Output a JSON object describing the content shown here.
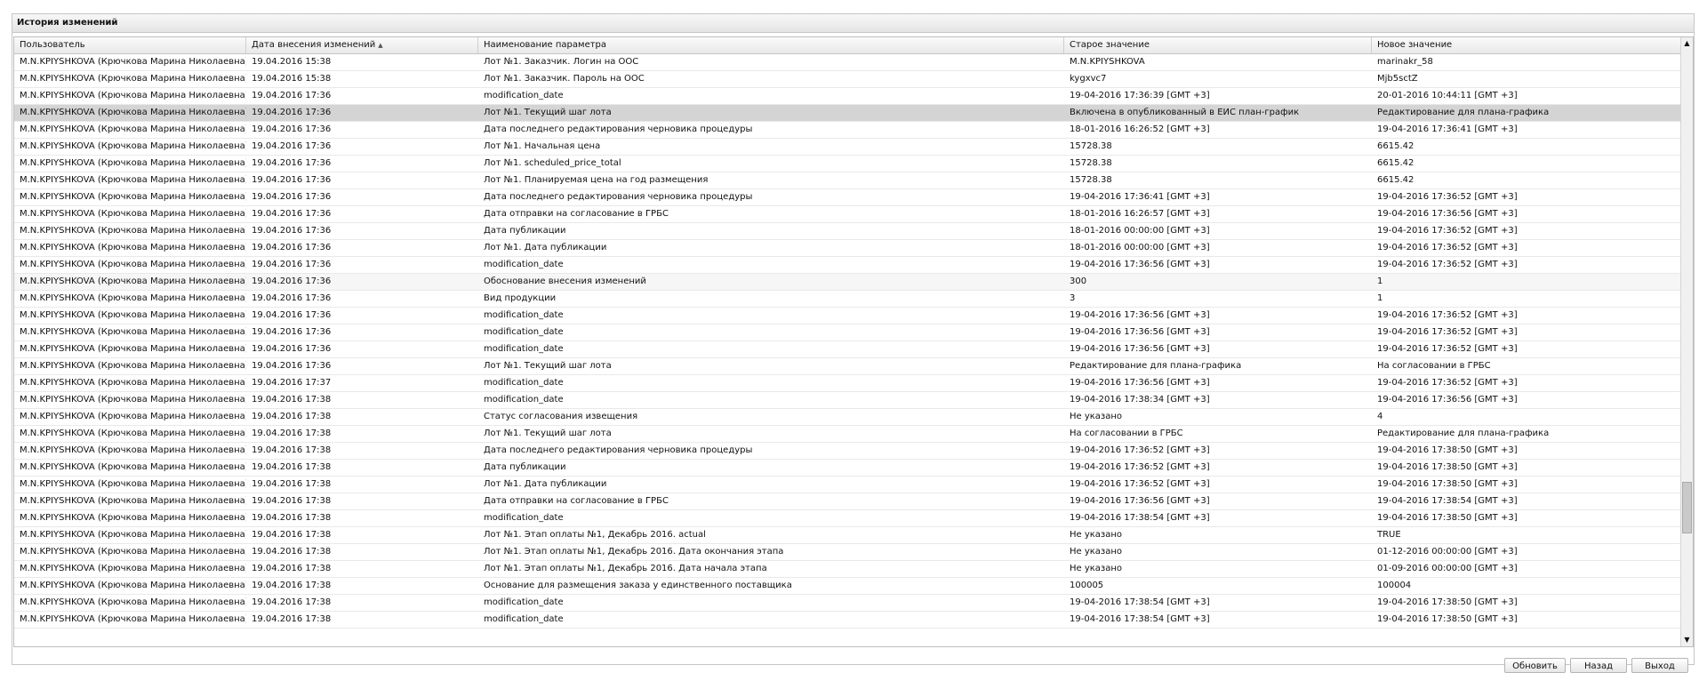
{
  "panel": {
    "title": "История изменений"
  },
  "columns": [
    {
      "label": "Пользователь",
      "sorted": false
    },
    {
      "label": "Дата внесения изменений",
      "sorted": true
    },
    {
      "label": "Наименование параметра",
      "sorted": false
    },
    {
      "label": "Старое значение",
      "sorted": false
    },
    {
      "label": "Новое значение",
      "sorted": false
    }
  ],
  "sort_icon": "sort-ascending-icon",
  "rows": [
    [
      "M.N.KPIYSHKOVA (Крючкова Марина Николаевна)",
      "19.04.2016 15:38",
      "Лот №1. Заказчик. Логин на ООС",
      "M.N.KPIYSHKOVA",
      "marinakr_58"
    ],
    [
      "M.N.KPIYSHKOVA (Крючкова Марина Николаевна)",
      "19.04.2016 15:38",
      "Лот №1. Заказчик. Пароль на ООС",
      "kygxvc7",
      "Mjb5sctZ"
    ],
    [
      "M.N.KPIYSHKOVA (Крючкова Марина Николаевна)",
      "19.04.2016 17:36",
      "modification_date",
      "19-04-2016 17:36:39 [GMT +3]",
      "20-01-2016 10:44:11 [GMT +3]"
    ],
    [
      "M.N.KPIYSHKOVA (Крючкова Марина Николаевна)",
      "19.04.2016 17:36",
      "Лот №1. Текущий шаг лота",
      "Включена в опубликованный в ЕИС план-график",
      "Редактирование для плана-графика"
    ],
    [
      "M.N.KPIYSHKOVA (Крючкова Марина Николаевна)",
      "19.04.2016 17:36",
      "Дата последнего редактирования черновика процедуры",
      "18-01-2016 16:26:52 [GMT +3]",
      "19-04-2016 17:36:41 [GMT +3]"
    ],
    [
      "M.N.KPIYSHKOVA (Крючкова Марина Николаевна)",
      "19.04.2016 17:36",
      "Лот №1. Начальная цена",
      "15728.38",
      "6615.42"
    ],
    [
      "M.N.KPIYSHKOVA (Крючкова Марина Николаевна)",
      "19.04.2016 17:36",
      "Лот №1. scheduled_price_total",
      "15728.38",
      "6615.42"
    ],
    [
      "M.N.KPIYSHKOVA (Крючкова Марина Николаевна)",
      "19.04.2016 17:36",
      "Лот №1. Планируемая цена на год размещения",
      "15728.38",
      "6615.42"
    ],
    [
      "M.N.KPIYSHKOVA (Крючкова Марина Николаевна)",
      "19.04.2016 17:36",
      "Дата последнего редактирования черновика процедуры",
      "19-04-2016 17:36:41 [GMT +3]",
      "19-04-2016 17:36:52 [GMT +3]"
    ],
    [
      "M.N.KPIYSHKOVA (Крючкова Марина Николаевна)",
      "19.04.2016 17:36",
      "Дата отправки на согласование в ГРБС",
      "18-01-2016 16:26:57 [GMT +3]",
      "19-04-2016 17:36:56 [GMT +3]"
    ],
    [
      "M.N.KPIYSHKOVA (Крючкова Марина Николаевна)",
      "19.04.2016 17:36",
      "Дата публикации",
      "18-01-2016 00:00:00 [GMT +3]",
      "19-04-2016 17:36:52 [GMT +3]"
    ],
    [
      "M.N.KPIYSHKOVA (Крючкова Марина Николаевна)",
      "19.04.2016 17:36",
      "Лот №1. Дата публикации",
      "18-01-2016 00:00:00 [GMT +3]",
      "19-04-2016 17:36:52 [GMT +3]"
    ],
    [
      "M.N.KPIYSHKOVA (Крючкова Марина Николаевна)",
      "19.04.2016 17:36",
      "modification_date",
      "19-04-2016 17:36:56 [GMT +3]",
      "19-04-2016 17:36:52 [GMT +3]"
    ],
    [
      "M.N.KPIYSHKOVA (Крючкова Марина Николаевна)",
      "19.04.2016 17:36",
      "Обоснование внесения изменений",
      "300",
      "1"
    ],
    [
      "M.N.KPIYSHKOVA (Крючкова Марина Николаевна)",
      "19.04.2016 17:36",
      "Вид продукции",
      "3",
      "1"
    ],
    [
      "M.N.KPIYSHKOVA (Крючкова Марина Николаевна)",
      "19.04.2016 17:36",
      "modification_date",
      "19-04-2016 17:36:56 [GMT +3]",
      "19-04-2016 17:36:52 [GMT +3]"
    ],
    [
      "M.N.KPIYSHKOVA (Крючкова Марина Николаевна)",
      "19.04.2016 17:36",
      "modification_date",
      "19-04-2016 17:36:56 [GMT +3]",
      "19-04-2016 17:36:52 [GMT +3]"
    ],
    [
      "M.N.KPIYSHKOVA (Крючкова Марина Николаевна)",
      "19.04.2016 17:36",
      "modification_date",
      "19-04-2016 17:36:56 [GMT +3]",
      "19-04-2016 17:36:52 [GMT +3]"
    ],
    [
      "M.N.KPIYSHKOVA (Крючкова Марина Николаевна)",
      "19.04.2016 17:36",
      "Лот №1. Текущий шаг лота",
      "Редактирование для плана-графика",
      "На согласовании в ГРБС"
    ],
    [
      "M.N.KPIYSHKOVA (Крючкова Марина Николаевна)",
      "19.04.2016 17:37",
      "modification_date",
      "19-04-2016 17:36:56 [GMT +3]",
      "19-04-2016 17:36:52 [GMT +3]"
    ],
    [
      "M.N.KPIYSHKOVA (Крючкова Марина Николаевна)",
      "19.04.2016 17:38",
      "modification_date",
      "19-04-2016 17:38:34 [GMT +3]",
      "19-04-2016 17:36:56 [GMT +3]"
    ],
    [
      "M.N.KPIYSHKOVA (Крючкова Марина Николаевна)",
      "19.04.2016 17:38",
      "Статус согласования извещения",
      "Не указано",
      "4"
    ],
    [
      "M.N.KPIYSHKOVA (Крючкова Марина Николаевна)",
      "19.04.2016 17:38",
      "Лот №1. Текущий шаг лота",
      "На согласовании в ГРБС",
      "Редактирование для плана-графика"
    ],
    [
      "M.N.KPIYSHKOVA (Крючкова Марина Николаевна)",
      "19.04.2016 17:38",
      "Дата последнего редактирования черновика процедуры",
      "19-04-2016 17:36:52 [GMT +3]",
      "19-04-2016 17:38:50 [GMT +3]"
    ],
    [
      "M.N.KPIYSHKOVA (Крючкова Марина Николаевна)",
      "19.04.2016 17:38",
      "Дата публикации",
      "19-04-2016 17:36:52 [GMT +3]",
      "19-04-2016 17:38:50 [GMT +3]"
    ],
    [
      "M.N.KPIYSHKOVA (Крючкова Марина Николаевна)",
      "19.04.2016 17:38",
      "Лот №1. Дата публикации",
      "19-04-2016 17:36:52 [GMT +3]",
      "19-04-2016 17:38:50 [GMT +3]"
    ],
    [
      "M.N.KPIYSHKOVA (Крючкова Марина Николаевна)",
      "19.04.2016 17:38",
      "Дата отправки на согласование в ГРБС",
      "19-04-2016 17:36:56 [GMT +3]",
      "19-04-2016 17:38:54 [GMT +3]"
    ],
    [
      "M.N.KPIYSHKOVA (Крючкова Марина Николаевна)",
      "19.04.2016 17:38",
      "modification_date",
      "19-04-2016 17:38:54 [GMT +3]",
      "19-04-2016 17:38:50 [GMT +3]"
    ],
    [
      "M.N.KPIYSHKOVA (Крючкова Марина Николаевна)",
      "19.04.2016 17:38",
      "Лот №1. Этап оплаты №1, Декабрь 2016. actual",
      "Не указано",
      "TRUE"
    ],
    [
      "M.N.KPIYSHKOVA (Крючкова Марина Николаевна)",
      "19.04.2016 17:38",
      "Лот №1. Этап оплаты №1, Декабрь 2016. Дата окончания этапа",
      "Не указано",
      "01-12-2016 00:00:00 [GMT +3]"
    ],
    [
      "M.N.KPIYSHKOVA (Крючкова Марина Николаевна)",
      "19.04.2016 17:38",
      "Лот №1. Этап оплаты №1, Декабрь 2016. Дата начала этапа",
      "Не указано",
      "01-09-2016 00:00:00 [GMT +3]"
    ],
    [
      "M.N.KPIYSHKOVA (Крючкова Марина Николаевна)",
      "19.04.2016 17:38",
      "Основание для размещения заказа у единственного поставщика",
      "100005",
      "100004"
    ],
    [
      "M.N.KPIYSHKOVA (Крючкова Марина Николаевна)",
      "19.04.2016 17:38",
      "modification_date",
      "19-04-2016 17:38:54 [GMT +3]",
      "19-04-2016 17:38:50 [GMT +3]"
    ],
    [
      "M.N.KPIYSHKOVA (Крючкова Марина Николаевна)",
      "19.04.2016 17:38",
      "modification_date",
      "19-04-2016 17:38:54 [GMT +3]",
      "19-04-2016 17:38:50 [GMT +3]"
    ]
  ],
  "selected_row": 3,
  "alt_rows": [
    13
  ],
  "buttons": {
    "refresh": "Обновить",
    "back": "Назад",
    "exit": "Выход"
  },
  "icons": {
    "scroll_up": "scroll-up-arrow-icon",
    "scroll_down": "scroll-down-arrow-icon"
  }
}
